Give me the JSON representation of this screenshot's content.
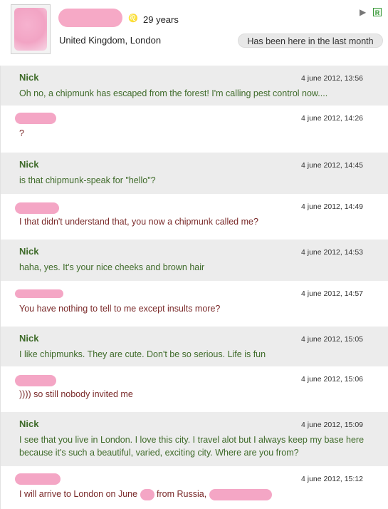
{
  "profile": {
    "age": "29 years",
    "location": "United Kingdom, London",
    "presence": "Has been here in the last month",
    "badge": "R"
  },
  "messages": [
    {
      "sender": "Nick",
      "time": "4 june 2012, 13:56",
      "text": "Oh no, a chipmunk has escaped from the forest! I'm calling pest control now...."
    },
    {
      "sender": "",
      "time": "4 june 2012, 14:26",
      "text": "?"
    },
    {
      "sender": "Nick",
      "time": "4 june 2012, 14:45",
      "text": "is that chipmunk-speak for \"hello\"?"
    },
    {
      "sender": "",
      "time": "4 june 2012, 14:49",
      "text": "I that didn't understand that, you now a chipmunk called me?"
    },
    {
      "sender": "Nick",
      "time": "4 june 2012, 14:53",
      "text": "haha, yes. It's your nice cheeks and brown hair"
    },
    {
      "sender": "",
      "time": "4 june 2012, 14:57",
      "text": "You have nothing to tell to me except insults more?"
    },
    {
      "sender": "Nick",
      "time": "4 june 2012, 15:05",
      "text": "I like chipmunks. They are cute. Don't be so serious. Life is fun"
    },
    {
      "sender": "",
      "time": "4 june 2012, 15:06",
      "text": ")))) so still nobody invited me"
    },
    {
      "sender": "Nick",
      "time": "4 june 2012, 15:09",
      "text": "I see that you live in London. I love this city. I travel alot but I always keep my base here because it's such a beautiful, varied, exciting city. Where are you from?"
    },
    {
      "sender": "",
      "time": "4 june 2012, 15:12",
      "text_parts": [
        "I will arrive to London on June",
        "from Russia,"
      ]
    }
  ]
}
